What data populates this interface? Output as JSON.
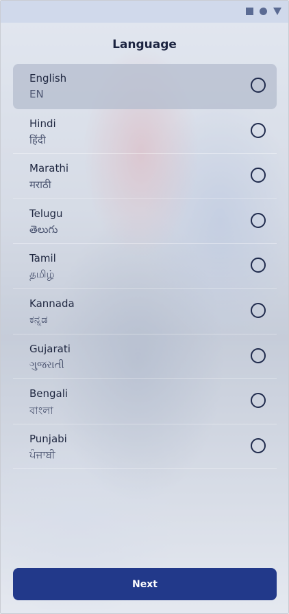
{
  "window": {
    "icons": [
      "square-icon",
      "circle-icon",
      "triangle-down-icon"
    ]
  },
  "header": {
    "title": "Language"
  },
  "languages": [
    {
      "name": "English",
      "native": "EN",
      "selected": true
    },
    {
      "name": "Hindi",
      "native": "हिंदी",
      "selected": false
    },
    {
      "name": "Marathi",
      "native": "मराठी",
      "selected": false
    },
    {
      "name": "Telugu",
      "native": "తెలుగు",
      "selected": false
    },
    {
      "name": "Tamil",
      "native": "தமிழ்",
      "selected": false
    },
    {
      "name": "Kannada",
      "native": "ಕನ್ನಡ",
      "selected": false
    },
    {
      "name": "Gujarati",
      "native": "ગુજરાતી",
      "selected": false
    },
    {
      "name": "Bengali",
      "native": "বাংলা",
      "selected": false
    },
    {
      "name": "Punjabi",
      "native": "ਪੰਜਾਬੀ",
      "selected": false
    }
  ],
  "footer": {
    "next_label": "Next"
  },
  "colors": {
    "accent": "#22398a",
    "radio_border": "#1f2a4c",
    "title_text": "#1b2340",
    "window_icons": "#5b6b93"
  }
}
